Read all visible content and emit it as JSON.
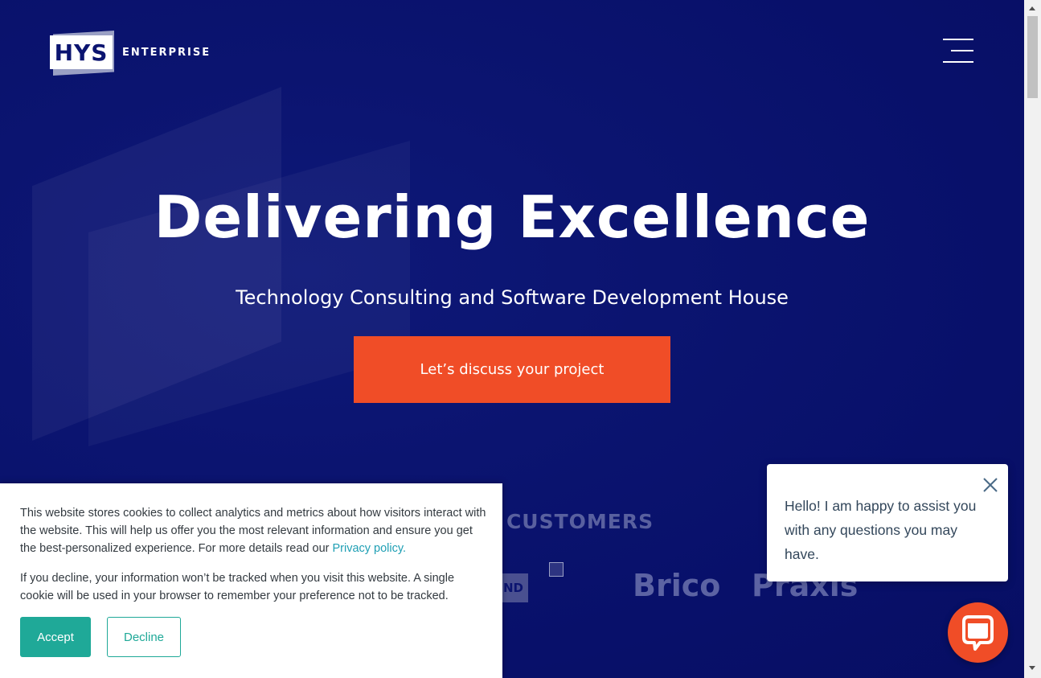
{
  "header": {
    "logo_mark": "HYS",
    "logo_word": "ENTERPRISE",
    "menu_icon": "hamburger-menu-icon"
  },
  "hero": {
    "headline": "Delivering Excellence",
    "subheadline": "Technology Consulting and Software Development House",
    "cta_label": "Let’s discuss your project"
  },
  "customers": {
    "title_visible": "R CUSTOMERS",
    "partial_logo_text": "ND",
    "logos": [
      "Brico",
      "Praxis"
    ],
    "broken_image_icon": "broken-image-icon"
  },
  "cookie_banner": {
    "text1": "This website stores cookies to collect analytics and metrics about how visitors interact with the website. This will help us offer you the most relevant information and ensure you get the best-personalized experience. For more details read our ",
    "privacy_link": "Privacy policy",
    "text1_end": ".",
    "text2": "If you decline, your information won’t be tracked when you visit this website. A single cookie will be used in your browser to remember your preference not to be tracked.",
    "accept_label": "Accept",
    "decline_label": "Decline"
  },
  "chat": {
    "message": "Hello! I am happy to assist you with any questions you may have.",
    "close_icon": "close-icon",
    "launcher_icon": "chat-icon"
  },
  "colors": {
    "hero_bg": "#0b1470",
    "cta": "#f04d27",
    "accent_teal": "#1fa998",
    "link": "#1f9fb4"
  }
}
